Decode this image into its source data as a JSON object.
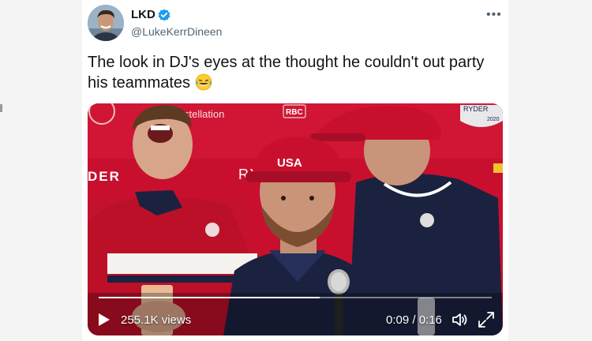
{
  "author": {
    "name": "LKD",
    "handle": "@LukeKerrDineen",
    "avatar_icon": "avatar-photo",
    "verified_icon": "verified-badge-icon"
  },
  "menu": {
    "more_label": "•••"
  },
  "tweet": {
    "text": "The look in DJ's eyes at the thought he couldn't out party his teammates",
    "emoji_icon": "laughing-tears-emoji"
  },
  "video": {
    "views": "255.1K views",
    "time": "0:09 / 0:16",
    "progress_fraction": 0.5625,
    "backdrop": {
      "left_text": "stellation",
      "left_banner": "DER",
      "center_text": "RYDE",
      "badge_text": "RBC",
      "crest_text": "RYDER",
      "crest_year": "2020",
      "cap_text": "USA"
    },
    "controls": {
      "play_icon": "play-icon",
      "volume_icon": "volume-icon",
      "fullscreen_icon": "fullscreen-icon"
    }
  },
  "colors": {
    "brand_red": "#c8102e",
    "verified_blue": "#1d9bf0",
    "navy": "#1b2240"
  }
}
